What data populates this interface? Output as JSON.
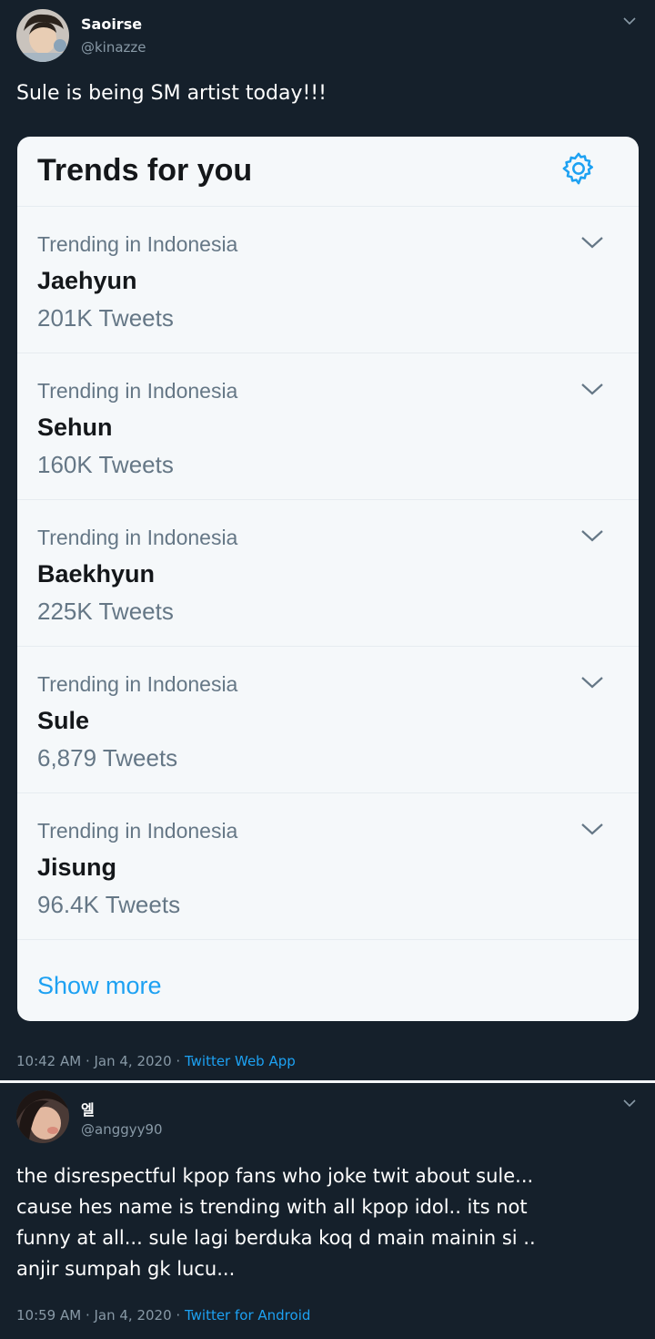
{
  "tweet1": {
    "display_name": "Saoirse",
    "handle": "@kinazze",
    "text": "Sule is being SM artist today!!!",
    "timestamp": "10:42 AM · Jan 4, 2020 · ",
    "source": "Twitter Web App",
    "card": {
      "title": "Trends for you",
      "settings_icon": "gear-icon",
      "trends": [
        {
          "context": "Trending in Indonesia",
          "name": "Jaehyun",
          "count": "201K Tweets"
        },
        {
          "context": "Trending in Indonesia",
          "name": "Sehun",
          "count": "160K Tweets"
        },
        {
          "context": "Trending in Indonesia",
          "name": "Baekhyun",
          "count": "225K Tweets"
        },
        {
          "context": "Trending in Indonesia",
          "name": "Sule",
          "count": "6,879 Tweets"
        },
        {
          "context": "Trending in Indonesia",
          "name": "Jisung",
          "count": "96.4K Tweets"
        }
      ],
      "show_more": "Show more"
    }
  },
  "tweet2": {
    "display_name": "엘",
    "handle": "@anggyy90",
    "text_lines": [
      "the disrespectful kpop fans who joke twit about sule...",
      "cause hes name is trending with all kpop idol.. its not",
      "funny at all... sule lagi berduka koq d main mainin si ..",
      "anjir sumpah gk lucu..."
    ],
    "timestamp": "10:59 AM · Jan 4, 2020 · ",
    "source": "Twitter for Android"
  },
  "colors": {
    "background": "#15202b",
    "card": "#f5f8fa",
    "accent": "#1da1f2",
    "muted": "#8899a6"
  }
}
